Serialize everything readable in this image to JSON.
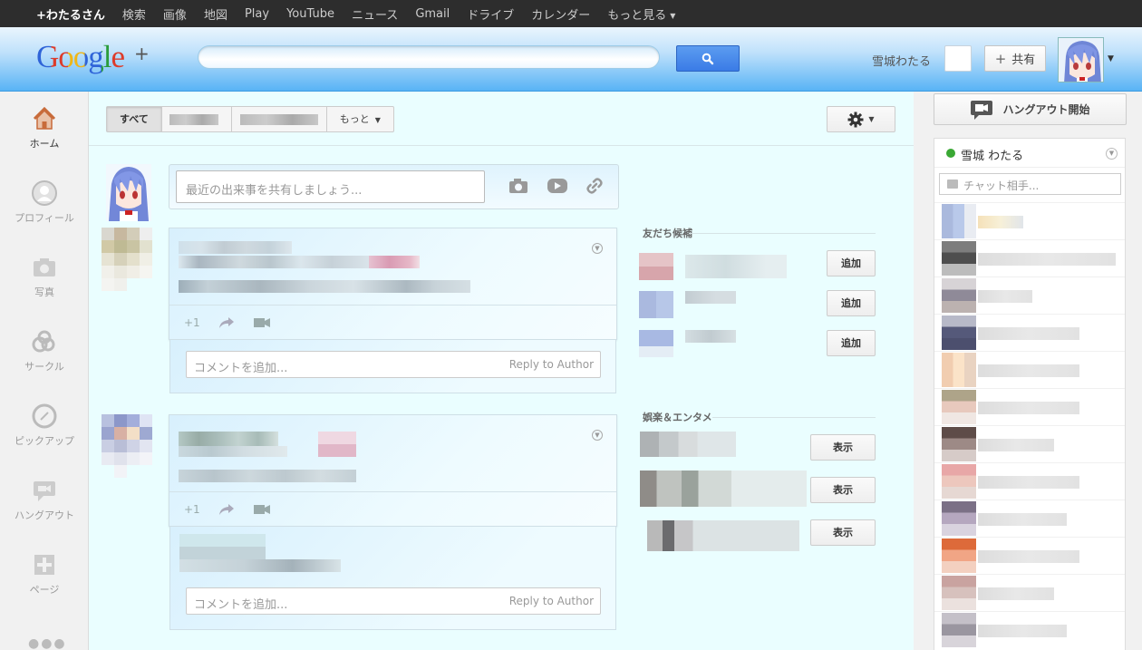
{
  "topbar": {
    "items": [
      "+わたるさん",
      "検索",
      "画像",
      "地図",
      "Play",
      "YouTube",
      "ニュース",
      "Gmail",
      "ドライブ",
      "カレンダー",
      "もっと見る"
    ]
  },
  "header": {
    "logo": "Google",
    "logo_plus": "+",
    "username": "雪城わたる",
    "share_label": "共有"
  },
  "nav": {
    "items": [
      {
        "label": "ホーム",
        "icon": "home-icon"
      },
      {
        "label": "プロフィール",
        "icon": "profile-icon"
      },
      {
        "label": "写真",
        "icon": "camera-icon"
      },
      {
        "label": "サークル",
        "icon": "circles-icon"
      },
      {
        "label": "ピックアップ",
        "icon": "compass-icon"
      },
      {
        "label": "ハングアウト",
        "icon": "hangout-icon"
      },
      {
        "label": "ページ",
        "icon": "pages-icon"
      }
    ],
    "more": "●●●"
  },
  "stream": {
    "tabs": {
      "all": "すべて",
      "more": "もっと"
    },
    "share_placeholder": "最近の出来事を共有しましょう...",
    "comment_placeholder": "コメントを追加...",
    "reply_to_author": "Reply to Author",
    "plus_one": "+1"
  },
  "suggestions": {
    "friends_title": "友だち候補",
    "add_label": "追加",
    "entertainment_title": "娯楽＆エンタメ",
    "show_label": "表示"
  },
  "chat": {
    "hangout_button": "ハングアウト開始",
    "user_name": "雪城 わたる",
    "search_placeholder": "チャット相手..."
  },
  "colors": {
    "online": "#3aa834",
    "search_button": "#3a7be6",
    "stream_bg": "#eafeff"
  }
}
